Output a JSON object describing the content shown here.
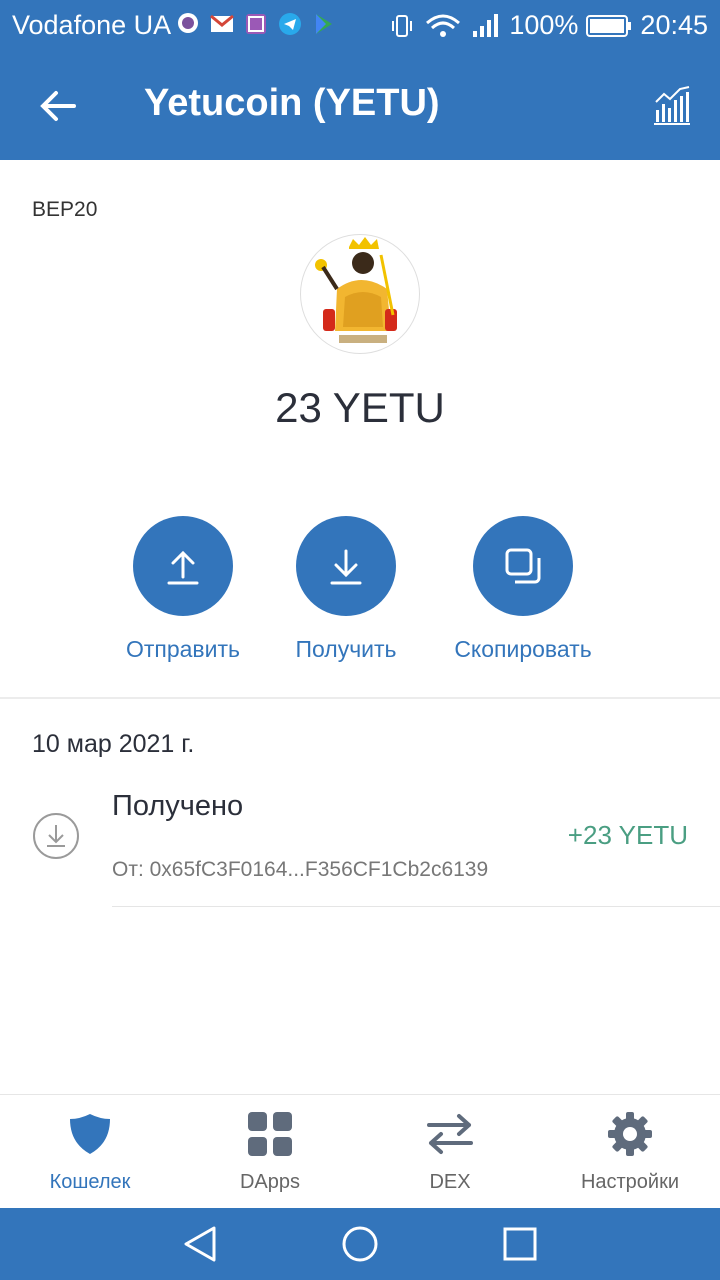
{
  "status_bar": {
    "carrier": "Vodafone UA",
    "notification_icons": [
      "viber-icon",
      "gmail-icon",
      "gallery-icon",
      "telegram-icon",
      "play-store-icon"
    ],
    "battery": "100%",
    "time": "20:45"
  },
  "header": {
    "title": "Yetucoin (YETU)"
  },
  "token": {
    "network": "BEP20",
    "balance": "23 YETU"
  },
  "actions": {
    "send": "Отправить",
    "receive": "Получить",
    "copy": "Скопировать"
  },
  "transactions": {
    "date": "10 мар 2021 г.",
    "items": [
      {
        "title": "Получено",
        "from": "От: 0x65fC3F0164...F356CF1Cb2c6139",
        "amount": "+23 YETU"
      }
    ]
  },
  "bottom_nav": {
    "items": [
      {
        "label": "Кошелек",
        "icon": "shield-icon"
      },
      {
        "label": "DApps",
        "icon": "grid-icon"
      },
      {
        "label": "DEX",
        "icon": "swap-arrows-icon"
      },
      {
        "label": "Настройки",
        "icon": "gear-icon"
      }
    ]
  },
  "colors": {
    "primary": "#3375bb",
    "positive": "#4a9e82"
  }
}
